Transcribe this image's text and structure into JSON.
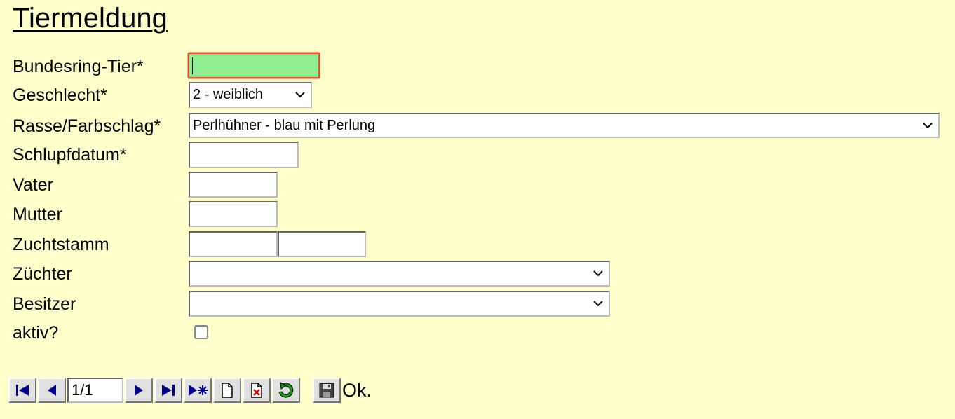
{
  "title": "Tiermeldung",
  "form": {
    "ring_label": "Bundesring-Tier*",
    "ring_value": "",
    "sex_label": "Geschlecht*",
    "sex_value": "2 - weiblich",
    "breed_label": "Rasse/Farbschlag*",
    "breed_value": "Perlhühner - blau mit Perlung",
    "hatch_label": "Schlupfdatum*",
    "hatch_value": "",
    "father_label": "Vater",
    "father_value": "",
    "mother_label": "Mutter",
    "mother_value": "",
    "stock_label": "Zuchtstamm",
    "stock_value_1": "",
    "stock_value_2": "",
    "breeder_label": "Züchter",
    "breeder_value": "",
    "owner_label": "Besitzer",
    "owner_value": "",
    "active_label": "aktiv?",
    "active_checked": false
  },
  "toolbar": {
    "record_position": "1/1",
    "status": "Ok.",
    "icons": [
      "first-record-icon",
      "previous-record-icon",
      "next-record-icon",
      "last-record-icon",
      "new-record-at-end-icon",
      "new-document-icon",
      "delete-document-icon",
      "refresh-icon",
      "save-disk-icon"
    ]
  },
  "colors": {
    "background": "#ffffcc",
    "focused_field": "#90ee90",
    "focus_border": "#d9552b",
    "nav_arrow": "#0000a0"
  }
}
